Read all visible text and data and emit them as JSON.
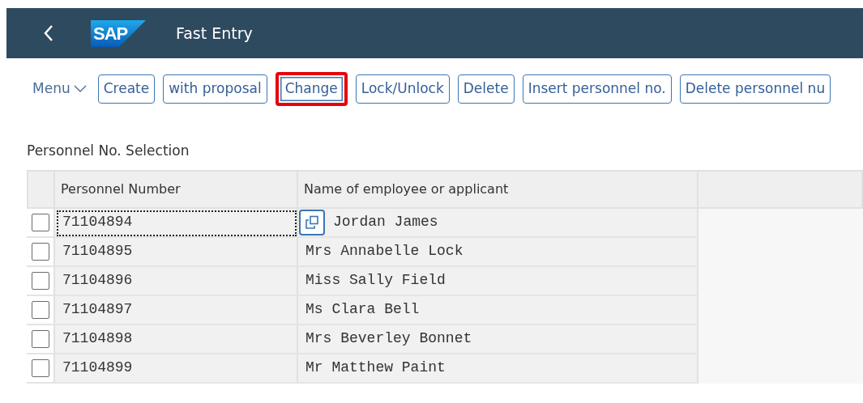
{
  "header": {
    "logo": "SAP",
    "title": "Fast Entry"
  },
  "toolbar": {
    "menu": "Menu",
    "buttons": [
      {
        "label": "Create",
        "highlighted": false
      },
      {
        "label": "with proposal",
        "highlighted": false
      },
      {
        "label": "Change",
        "highlighted": true
      },
      {
        "label": "Lock/Unlock",
        "highlighted": false
      },
      {
        "label": "Delete",
        "highlighted": false
      },
      {
        "label": "Insert personnel no.",
        "highlighted": false
      },
      {
        "label": "Delete personnel nu",
        "highlighted": false
      }
    ]
  },
  "section_title": "Personnel No. Selection",
  "table": {
    "columns": [
      "Personnel Number",
      "Name of employee or applicant"
    ],
    "rows": [
      {
        "number": "71104894",
        "name": "Jordan James",
        "checked": false,
        "focused": true
      },
      {
        "number": "71104895",
        "name": "Mrs Annabelle Lock",
        "checked": false,
        "focused": false
      },
      {
        "number": "71104896",
        "name": "Miss Sally Field",
        "checked": false,
        "focused": false
      },
      {
        "number": "71104897",
        "name": "Ms Clara Bell",
        "checked": false,
        "focused": false
      },
      {
        "number": "71104898",
        "name": "Mrs Beverley Bonnet",
        "checked": false,
        "focused": false
      },
      {
        "number": "71104899",
        "name": "Mr Matthew Paint",
        "checked": false,
        "focused": false
      }
    ]
  }
}
